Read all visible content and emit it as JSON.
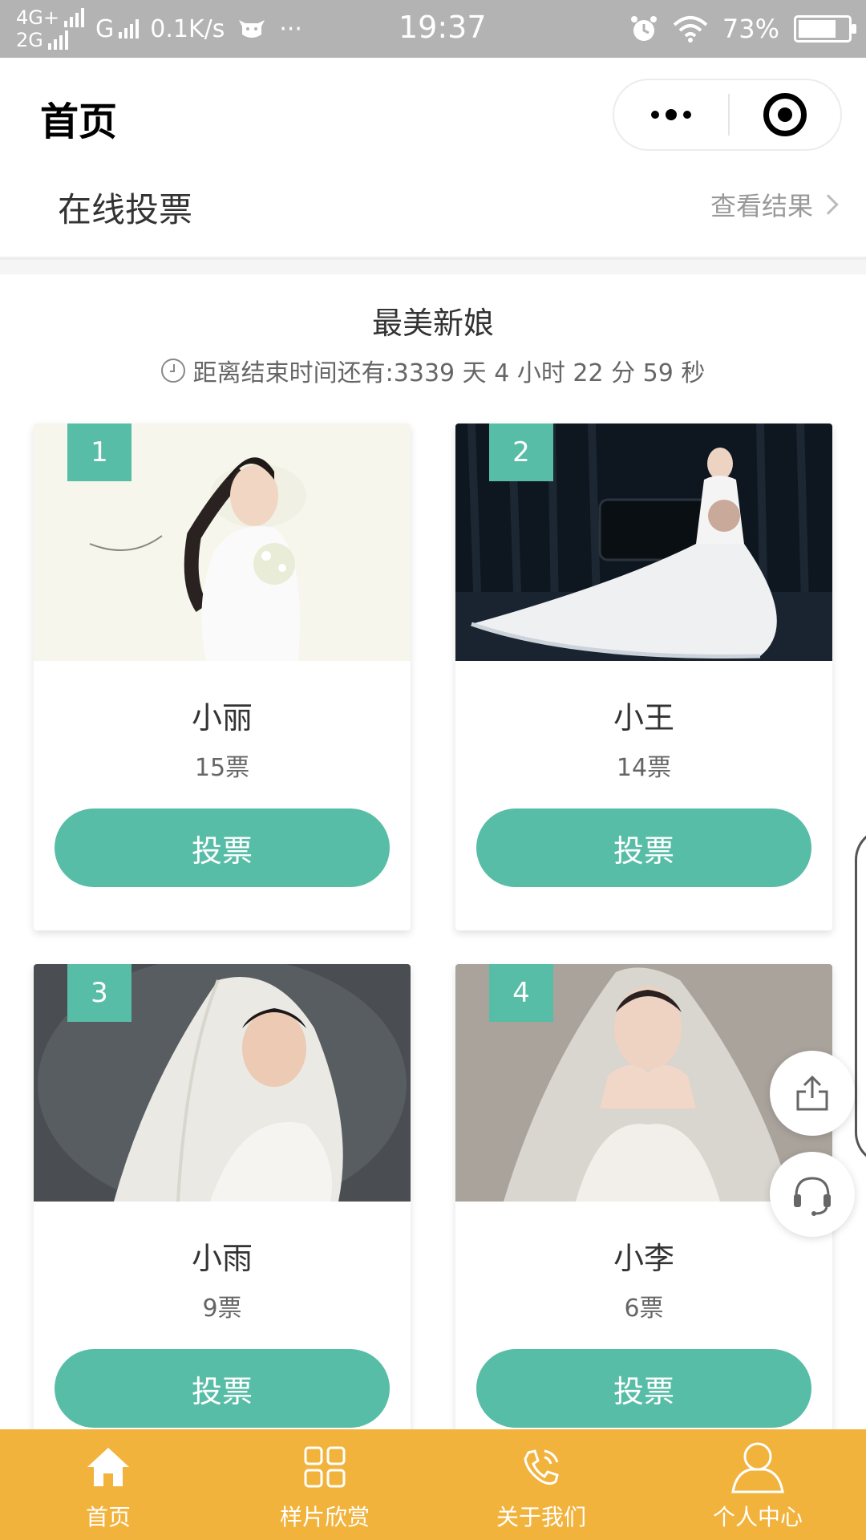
{
  "status_bar": {
    "net_line1": "4G+",
    "net_line2": "2G",
    "carrier": "G",
    "speed": "0.1K/s",
    "more": "···",
    "time": "19:37",
    "battery": "73%"
  },
  "nav": {
    "title": "首页"
  },
  "section": {
    "title": "在线投票",
    "results_link": "查看结果"
  },
  "vote": {
    "title": "最美新娘",
    "countdown": "距离结束时间还有:3339 天 4 小时 22 分 59 秒"
  },
  "candidates": [
    {
      "rank": "1",
      "name": "小丽",
      "votes": "15票",
      "button": "投票"
    },
    {
      "rank": "2",
      "name": "小王",
      "votes": "14票",
      "button": "投票"
    },
    {
      "rank": "3",
      "name": "小雨",
      "votes": "9票",
      "button": "投票"
    },
    {
      "rank": "4",
      "name": "小李",
      "votes": "6票",
      "button": "投票"
    }
  ],
  "tabbar": {
    "items": [
      {
        "label": "首页",
        "icon": "home-icon"
      },
      {
        "label": "样片欣赏",
        "icon": "grid-icon"
      },
      {
        "label": "关于我们",
        "icon": "phone-icon"
      },
      {
        "label": "个人中心",
        "icon": "user-icon"
      }
    ]
  },
  "colors": {
    "accent": "#57bda7",
    "tabbar": "#f2b33d",
    "statusbar": "#b3b3b3"
  }
}
